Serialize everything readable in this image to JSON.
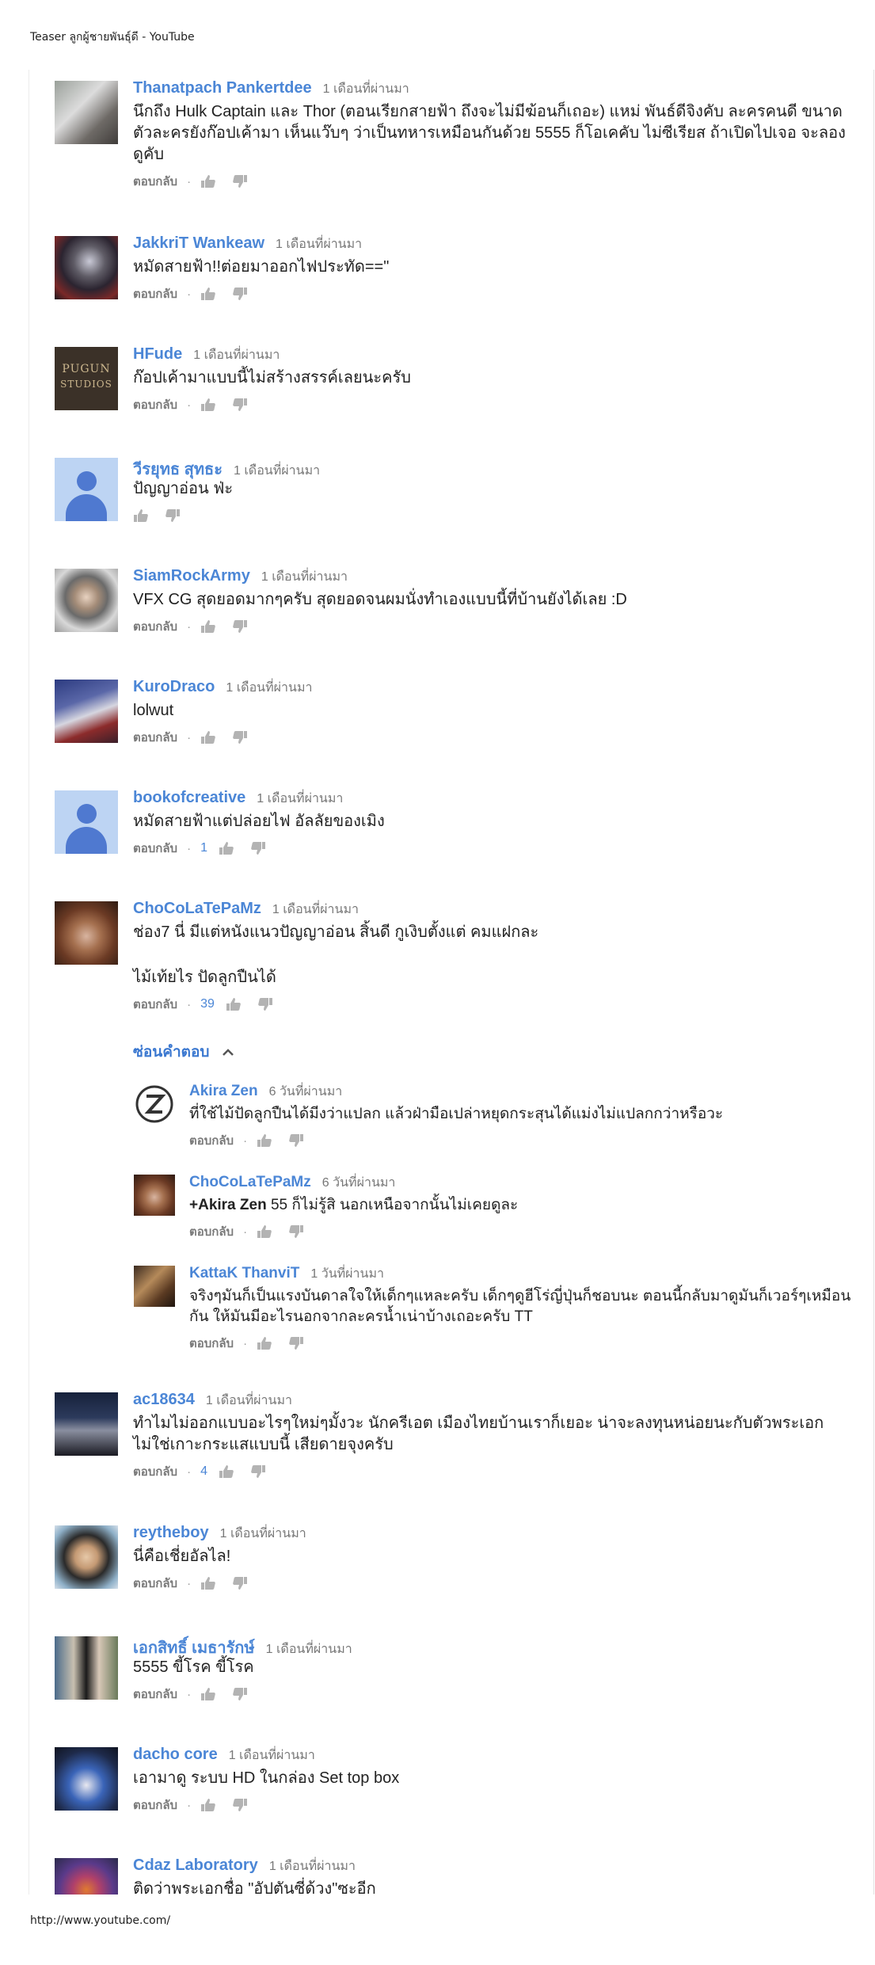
{
  "page": {
    "header_title": "Teaser ลูกผู้ชายพันธุ์ดี - YouTube",
    "footer_url": "http://www.youtube.com/"
  },
  "ui": {
    "reply_label": "ตอบกลับ",
    "separator": "·",
    "hide_replies_label": "ซ่อนคำตอบ"
  },
  "comments": [
    {
      "author": "Thanatpach Pankertdee",
      "time": "1 เดือนที่ผ่านมา",
      "text": "นึกถึง Hulk Captain และ Thor (ตอนเรียกสายฟ้า ถึงจะไม่มีฆ้อนก็เถอะ) แหม่ พันธ์ดีจิงคับ ละครคนดี ขนาดตัวละครยังก๊อปเค้ามา เห็นแว๊บๆ ว่าเป็นทหารเหมือนกันด้วย 5555 ก็โอเคคับ ไม่ซีเรียส ถ้าเปิดไปเจอ จะลองดูคับ",
      "likes": "",
      "avatar": "photo"
    },
    {
      "author": "JakkriT Wankeaw",
      "time": "1 เดือนที่ผ่านมา",
      "text": "หมัดสายฟ้า!!ต่อยมาออกไฟประทัด==\"",
      "likes": "",
      "avatar": "photo"
    },
    {
      "author": "HFude",
      "time": "1 เดือนที่ผ่านมา",
      "text": "ก๊อปเค้ามาแบบนี้ไม่สร้างสรรค์เลยนะครับ",
      "likes": "",
      "avatar": "pugun",
      "avatar_text_1": "PUGUN",
      "avatar_text_2": "STUDIOS"
    },
    {
      "author": "วีรยุทธ สุทธะ",
      "time": "1 เดือนที่ผ่านมา",
      "text": "ปัญญาอ่อน ฟ่ะ",
      "likes": "",
      "avatar": "default",
      "no_reply_link": true
    },
    {
      "author": "SiamRockArmy",
      "time": "1 เดือนที่ผ่านมา",
      "text": "VFX CG สุดยอดมากๆครับ สุดยอดจนผมนั่งทำเองแบบนี้ที่บ้านยังได้เลย :D",
      "likes": "",
      "avatar": "photo"
    },
    {
      "author": "KuroDraco",
      "time": "1 เดือนที่ผ่านมา",
      "text": "lolwut",
      "likes": "",
      "avatar": "photo"
    },
    {
      "author": "bookofcreative",
      "time": "1 เดือนที่ผ่านมา",
      "text": "หมัดสายฟ้าแต่ปล่อยไฟ อัลลัยของเมิง",
      "likes": "1",
      "avatar": "default"
    },
    {
      "author": "ChoCoLaTePaMz",
      "time": "1 เดือนที่ผ่านมา",
      "text_p1": "ช่อง7 นี่ มีแต่หนังแนวปัญญาอ่อน สิ้นดี กูเงิบตั้งแต่ คมแฝกละ",
      "text_p2": "ไม้เท้ยไร ปัดลูกปืนได้",
      "likes": "39",
      "avatar": "photo"
    },
    {
      "author": "ac18634",
      "time": "1 เดือนที่ผ่านมา",
      "text": "ทำไมไม่ออกแบบอะไรๆใหม่ๆมั้งวะ  นักครีเอต เมืองไทยบ้านเราก็เยอะ น่าจะลงทุนหน่อยนะกับตัวพระเอก ไม่ใช่เกาะกระแสแบบนี้ เสียดายจุงครับ",
      "likes": "4",
      "avatar": "photo"
    },
    {
      "author": "reytheboy",
      "time": "1 เดือนที่ผ่านมา",
      "text": "นี่คือเชี่ยอัลไล!",
      "likes": "",
      "avatar": "photo"
    },
    {
      "author": "เอกสิทธิ์ เมธารักษ์",
      "time": "1 เดือนที่ผ่านมา",
      "text": "5555  ขี้โรค ขี้โรค",
      "likes": "",
      "avatar": "photo"
    },
    {
      "author": "dacho core",
      "time": "1 เดือนที่ผ่านมา",
      "text": "เอามาดู ระบบ HD ในกล่อง Set top box",
      "likes": "",
      "avatar": "photo"
    },
    {
      "author": "Cdaz Laboratory",
      "time": "1 เดือนที่ผ่านมา",
      "text": "ติดว่าพระเอกชื่อ \"อัปตันซี่ด้วง\"ซะอีก",
      "likes": "",
      "avatar": "photo"
    }
  ],
  "replies": [
    {
      "author": "Akira Zen",
      "time": "6 วันที่ผ่านมา",
      "text": "ที่ใช้ไม้ปัดลูกปืนได้มีงว่าแปลก แล้วฝ่ามือเปล่าหยุดกระสุนได้แม่งไม่แปลกกว่าหรือวะ",
      "avatar": "logo"
    },
    {
      "author": "ChoCoLaTePaMz",
      "time": "6 วันที่ผ่านมา",
      "mention": "+Akira Zen",
      "text": "  55 ก็ไม่รู้สิ นอกเหนือจากนั้นไม่เคยดูละ",
      "avatar": "photo"
    },
    {
      "author": "KattaK ThanviT",
      "time": "1 วันที่ผ่านมา",
      "text": "จริงๆมันก็เป็นแรงบันดาลใจให้เด็กๆแหละครับ  เด็กๆดูฮีโร่ญี่ปุ่นก็ชอบนะ ตอนนี้กลับมาดูมันก็เวอร์ๆเหมือนกัน  ให้มันมีอะไรนอกจากละครน้ำเน่าบ้างเถอะครับ  TT",
      "avatar": "photo"
    }
  ],
  "colors": {
    "author": "#4b86d6",
    "meta": "#777777",
    "text": "#222222",
    "default_avatar_bg": "#bdd4f3",
    "default_avatar_fg": "#4f79d0"
  }
}
